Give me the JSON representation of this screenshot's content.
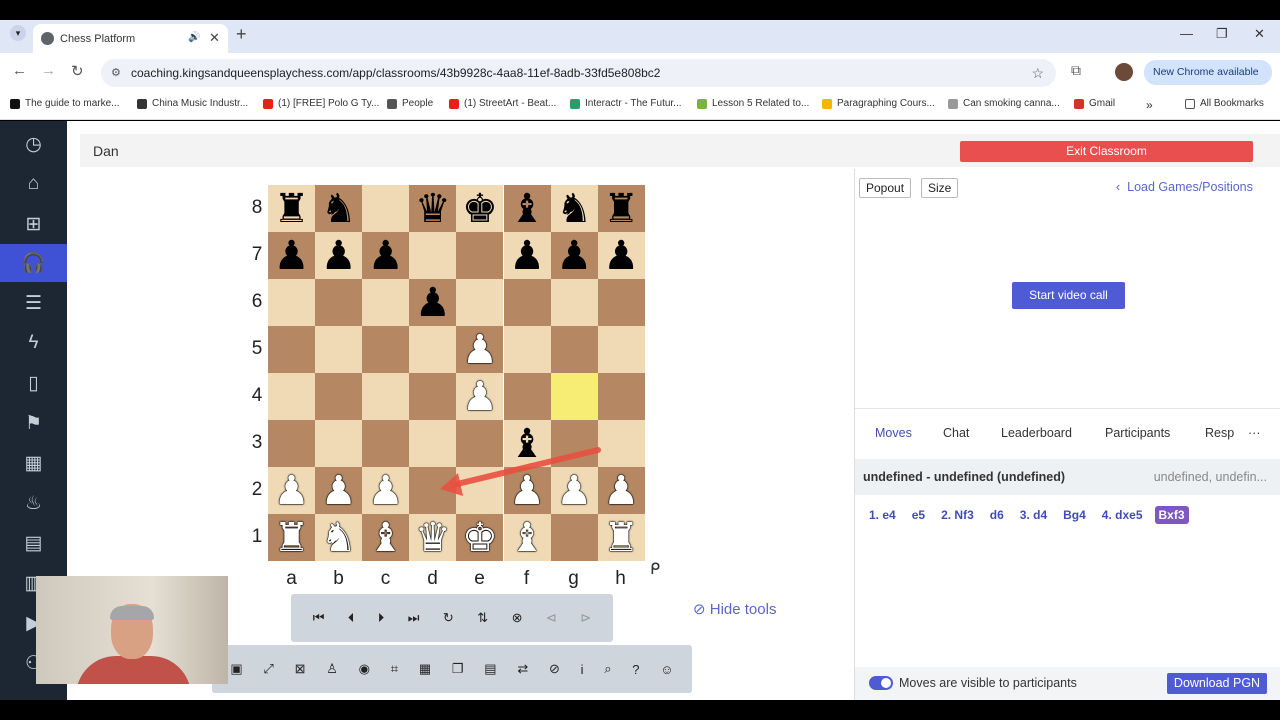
{
  "browser": {
    "tab_title": "Chess Platform",
    "url": "coaching.kingsandqueensplaychess.com/app/classrooms/43b9928c-4aa8-11ef-8adb-33fd5e808bc2",
    "new_chrome": "New Chrome available",
    "bookmarks": [
      "The guide to marke...",
      "China Music Industr...",
      "(1) [FREE] Polo G Ty...",
      "People",
      "(1) StreetArt - Beat...",
      "Interactr - The Futur...",
      "Lesson 5 Related to...",
      "Paragraphing Cours...",
      "Can smoking canna...",
      "Gmail",
      "All Bookmarks"
    ]
  },
  "header": {
    "name": "Dan",
    "exit_label": "Exit Classroom"
  },
  "board": {
    "ranks": [
      "8",
      "7",
      "6",
      "5",
      "4",
      "3",
      "2",
      "1"
    ],
    "files": [
      "a",
      "b",
      "c",
      "d",
      "e",
      "f",
      "g",
      "h"
    ],
    "rows": [
      [
        "br",
        "bn",
        "",
        "bq",
        "bk",
        "bb",
        "bn",
        "br"
      ],
      [
        "bp",
        "bp",
        "bp",
        "",
        "",
        "bp",
        "bp",
        "bp"
      ],
      [
        "",
        "",
        "",
        "bp",
        "",
        "",
        "",
        ""
      ],
      [
        "",
        "",
        "",
        "",
        "wp",
        "",
        "",
        ""
      ],
      [
        "",
        "",
        "",
        "",
        "wp",
        "",
        "",
        ""
      ],
      [
        "",
        "",
        "",
        "",
        "",
        "bb",
        "",
        ""
      ],
      [
        "wp",
        "wp",
        "wp",
        "",
        "",
        "wp",
        "wp",
        "wp"
      ],
      [
        "wr",
        "wn",
        "wb",
        "wq",
        "wk",
        "wb",
        "",
        "wr"
      ]
    ],
    "highlight_square": "g4",
    "arrow": "f3-d2"
  },
  "tools": {
    "hide_label": "Hide tools"
  },
  "right": {
    "popout": "Popout",
    "size": "Size",
    "load_games": "Load Games/Positions",
    "video": "Start video call",
    "tabs": [
      "Moves",
      "Chat",
      "Leaderboard",
      "Participants",
      "Resp"
    ],
    "more": "···",
    "game_title": "undefined - undefined (undefined)",
    "game_date": "undefined, undefin...",
    "moves": [
      "1. e4",
      "e5",
      "2. Nf3",
      "d6",
      "3. d4",
      "Bg4",
      "4. dxe5",
      "Bxf3"
    ],
    "toggle_label": "Moves are visible to participants",
    "pgn_label": "Download PGN"
  },
  "colors": {
    "accent": "#4f5bd5",
    "exit": "#ea4f4f",
    "sidebar": "#1c2733",
    "light_square": "#f0d9b5",
    "dark_square": "#b58863"
  }
}
